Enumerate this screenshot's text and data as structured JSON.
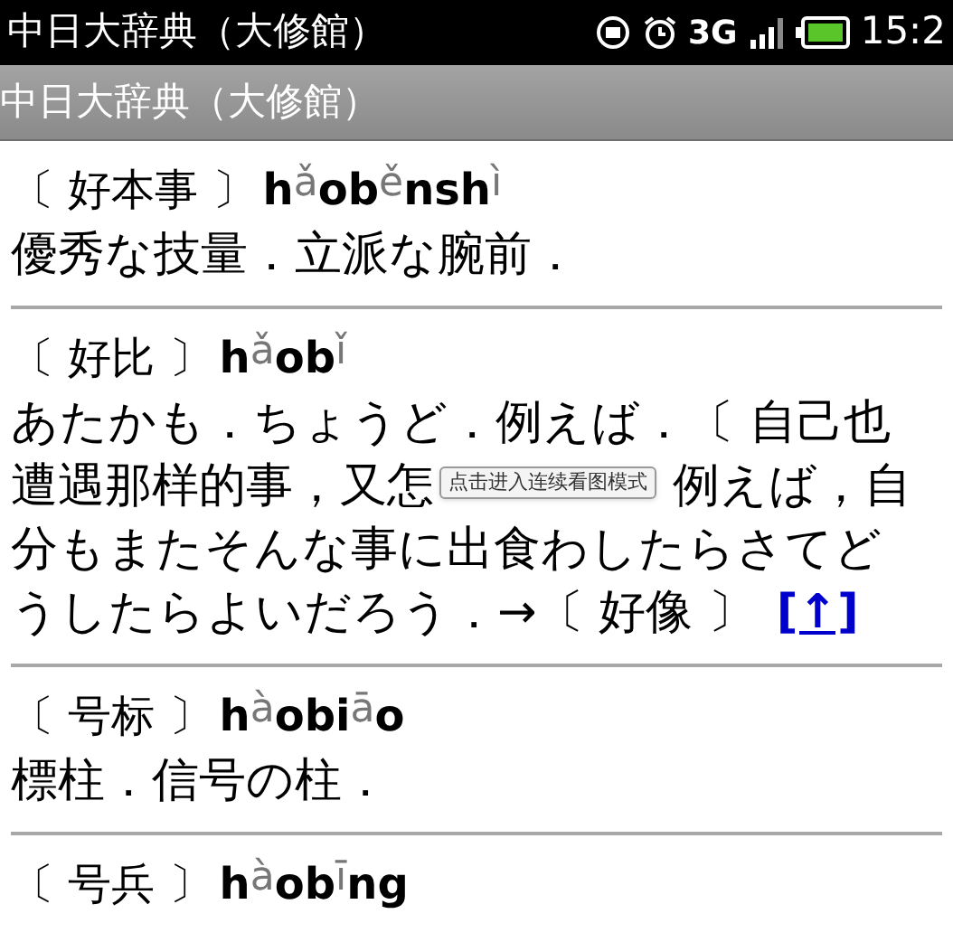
{
  "status_bar": {
    "app_title": "中日大辞典（大修館）",
    "network": "3G",
    "time": "15:2"
  },
  "action_bar": {
    "title": "中日大辞典（大修館）"
  },
  "entries": [
    {
      "headword": "〔 好本事 〕",
      "pinyin": [
        {
          "text": "h",
          "kind": "plain"
        },
        {
          "text": "ǎ",
          "kind": "tone"
        },
        {
          "text": "ob",
          "kind": "plain"
        },
        {
          "text": "ě",
          "kind": "tone"
        },
        {
          "text": "nsh",
          "kind": "plain"
        },
        {
          "text": "ì",
          "kind": "tone"
        }
      ],
      "definition_lines": [
        [
          "優秀な技量．立派な腕前．"
        ]
      ]
    },
    {
      "headword": "〔 好比 〕",
      "pinyin": [
        {
          "text": "h",
          "kind": "plain"
        },
        {
          "text": "ǎ",
          "kind": "tone"
        },
        {
          "text": "ob",
          "kind": "plain"
        },
        {
          "text": "ǐ",
          "kind": "tone"
        }
      ],
      "definition_lines": [
        [
          "あたかも．ちょうど．例えば．〔 自己也"
        ],
        [
          "遭遇那样的事，又怎",
          "例えば，自"
        ],
        [
          "分もまたそんな事に出食わしたらさてど"
        ],
        [
          "うしたらよいだろう．→〔 好像 〕"
        ]
      ],
      "link": "[↑]"
    },
    {
      "headword": "〔 号标 〕",
      "pinyin": [
        {
          "text": "h",
          "kind": "plain"
        },
        {
          "text": "à",
          "kind": "tone"
        },
        {
          "text": "obi",
          "kind": "plain"
        },
        {
          "text": "ā",
          "kind": "tone"
        },
        {
          "text": "o",
          "kind": "plain"
        }
      ],
      "definition_lines": [
        [
          "標柱．信号の柱．"
        ]
      ]
    },
    {
      "headword": "〔 号兵 〕",
      "pinyin": [
        {
          "text": "h",
          "kind": "plain"
        },
        {
          "text": "à",
          "kind": "tone"
        },
        {
          "text": "ob",
          "kind": "plain"
        },
        {
          "text": "ī",
          "kind": "tone"
        },
        {
          "text": "ng",
          "kind": "plain"
        }
      ]
    }
  ],
  "tooltip": "点击进入连续看图模式"
}
